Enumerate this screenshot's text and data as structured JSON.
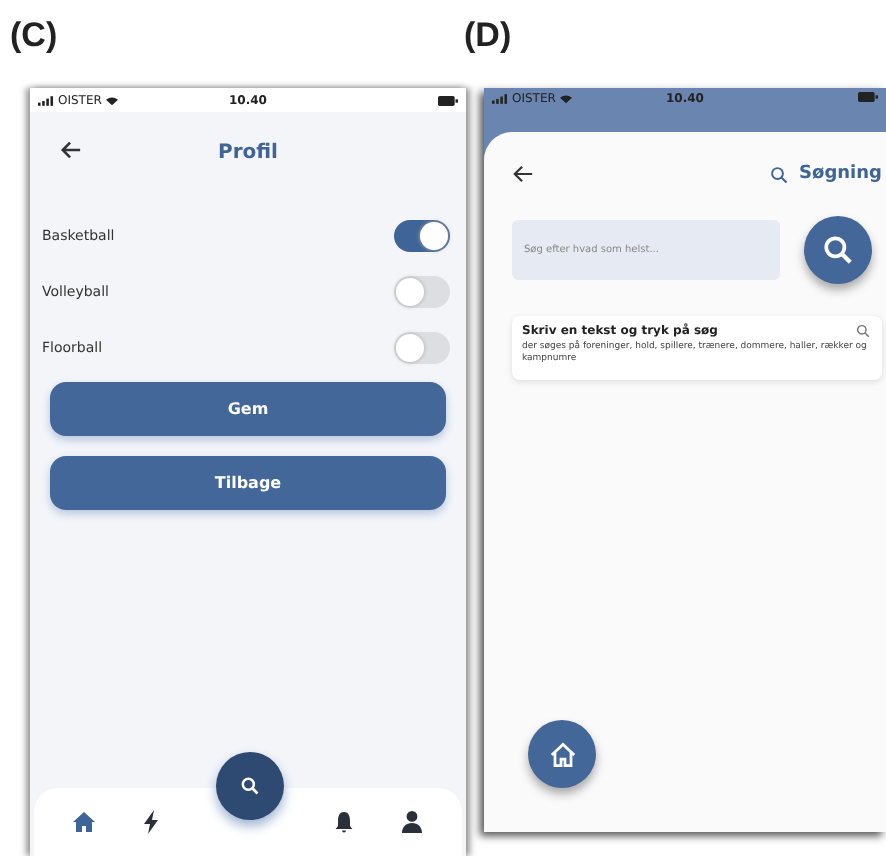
{
  "panel_c": {
    "label": "(C)",
    "status_bar": {
      "carrier": "OISTER",
      "time": "10.40"
    },
    "title": "Profil",
    "toggles": [
      {
        "label": "Basketball",
        "on": true
      },
      {
        "label": "Volleyball",
        "on": false
      },
      {
        "label": "Floorball",
        "on": false
      }
    ],
    "buttons": [
      "Gem",
      "Tilbage"
    ],
    "nav_items": [
      {
        "kind": "home",
        "selected": true
      },
      {
        "kind": "bolt",
        "selected": false
      },
      {
        "kind": "bell",
        "selected": false
      },
      {
        "kind": "user",
        "selected": false
      }
    ]
  },
  "panel_d": {
    "label": "(D)",
    "status_bar": {
      "carrier": "OISTER",
      "time": "10.40"
    },
    "title": "Søgning",
    "search": {
      "placeholder": "Søg efter hvad som helst..."
    },
    "hint": {
      "title": "Skriv en tekst og tryk på søg",
      "text": "der søges på foreninger, hold, spillere, trænere, dommere, haller, rækker og kampnumre"
    }
  }
}
